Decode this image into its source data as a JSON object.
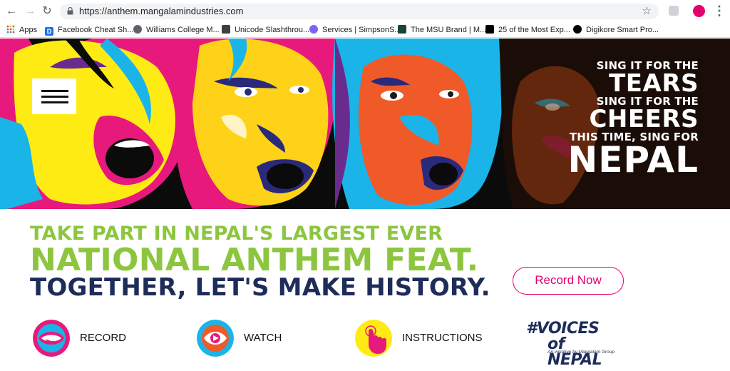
{
  "browser": {
    "url": "https://anthem.mangalamindustries.com",
    "bookmarks": [
      {
        "label": "Apps",
        "icon": "apps-grid-icon"
      },
      {
        "label": "Facebook Cheat Sh...",
        "icon": "d-favicon",
        "color": "#1a73e8"
      },
      {
        "label": "Williams College M...",
        "icon": "globe-favicon",
        "color": "#5f6368"
      },
      {
        "label": "Unicode Slashthrou...",
        "icon": "shop-favicon",
        "color": "#3c4043"
      },
      {
        "label": "Services | SimpsonS...",
        "icon": "s-favicon",
        "color": "#7b61ff"
      },
      {
        "label": "The MSU Brand | M...",
        "icon": "spartan-favicon",
        "color": "#18453b"
      },
      {
        "label": "25 of the Most Exp...",
        "icon": "ts-favicon",
        "color": "#000000"
      },
      {
        "label": "Digikore Smart Pro...",
        "icon": "dk-favicon",
        "color": "#000000"
      }
    ]
  },
  "hero": {
    "slogan": {
      "line1": "SING IT FOR THE",
      "line2": "TEARS",
      "line3": "SING IT FOR THE",
      "line4": "CHEERS",
      "line5": "THIS TIME, SING FOR",
      "line6": "NEPAL"
    }
  },
  "headline": {
    "line1": "TAKE PART IN NEPAL'S LARGEST EVER",
    "line2": "NATIONAL ANTHEM FEAT.",
    "line3": "TOGETHER, LET'S MAKE HISTORY."
  },
  "cta": {
    "record_now": "Record Now"
  },
  "features": [
    {
      "label": "RECORD",
      "icon": "mouth-icon"
    },
    {
      "label": "WATCH",
      "icon": "eye-icon"
    },
    {
      "label": "INSTRUCTIONS",
      "icon": "tap-hand-icon"
    }
  ],
  "brand": {
    "logo_line1": "#VOICES",
    "logo_line2": "of NEPAL",
    "tagline": "An initiative by Mangalam Group"
  },
  "colors": {
    "green": "#8cc63f",
    "navy": "#1e2c5a",
    "magenta": "#e6006e"
  }
}
